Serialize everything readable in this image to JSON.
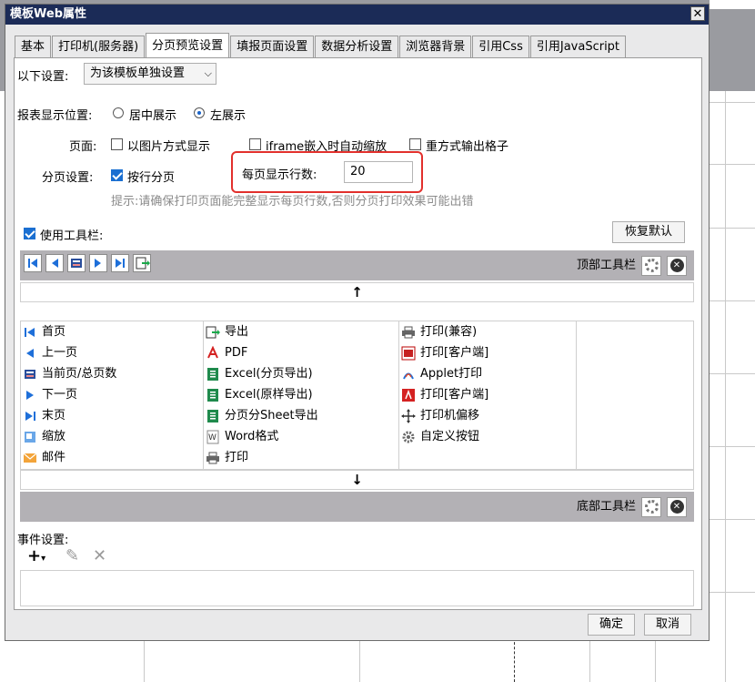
{
  "dialog": {
    "title": "模板Web属性",
    "close_glyph": "✕",
    "tabs": [
      "基本",
      "打印机(服务器)",
      "分页预览设置",
      "填报页面设置",
      "数据分析设置",
      "浏览器背景",
      "引用Css",
      "引用JavaScript"
    ],
    "active_tab": "分页预览设置"
  },
  "settings": {
    "scope_label": "以下设置:",
    "scope_value": "为该模板单独设置",
    "position_label": "报表显示位置:",
    "position_center": "居中展示",
    "position_left": "左展示",
    "position_selected": "左展示",
    "page_label": "页面:",
    "page_opt1": "以图片方式显示",
    "page_opt2": "iframe嵌入时自动缩放",
    "page_opt3": "重方式输出格子",
    "paging_label": "分页设置:",
    "paging_opt": "按行分页",
    "paging_checked": true,
    "rows_label": "每页显示行数:",
    "rows_value": "20",
    "hint": "提示:请确保打印页面能完整显示每页行数,否则分页打印效果可能出错"
  },
  "toolbar": {
    "use_toolbar_label": "使用工具栏:",
    "use_toolbar_checked": true,
    "restore_default": "恢复默认",
    "top_label": "顶部工具栏",
    "bottom_label": "底部工具栏",
    "up_arrow": "↑",
    "down_arrow": "↓",
    "columns": [
      [
        "首页",
        "上一页",
        "当前页/总页数",
        "下一页",
        "末页",
        "缩放",
        "邮件"
      ],
      [
        "导出",
        "PDF",
        "Excel(分页导出)",
        "Excel(原样导出)",
        "分页分Sheet导出",
        "Word格式",
        "打印"
      ],
      [
        "打印(兼容)",
        "打印[客户端]",
        "Applet打印",
        "打印[客户端]",
        "打印机偏移",
        "自定义按钮"
      ]
    ]
  },
  "events": {
    "label": "事件设置:"
  },
  "footer": {
    "ok": "确定",
    "cancel": "取消"
  }
}
